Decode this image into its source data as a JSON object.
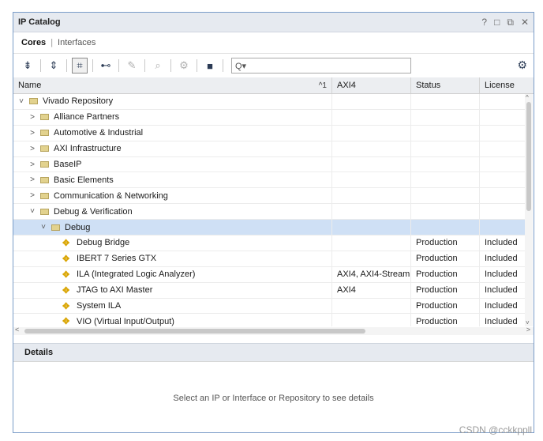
{
  "window": {
    "title": "IP Catalog",
    "controls": [
      "?",
      "□",
      "⧉",
      "✕"
    ]
  },
  "tabs": {
    "active": "Cores",
    "separator": "|",
    "other": "Interfaces"
  },
  "search": {
    "placeholder": "Q▾"
  },
  "columns": {
    "name": "Name",
    "sort_indicator": "^1",
    "axi4": "AXI4",
    "status": "Status",
    "license": "License"
  },
  "rows": [
    {
      "indent": 0,
      "expanded": "˅",
      "kind": "folder",
      "name": "Vivado Repository",
      "axi": "",
      "status": "",
      "license": ""
    },
    {
      "indent": 1,
      "expanded": ">",
      "kind": "folder",
      "name": "Alliance Partners",
      "axi": "",
      "status": "",
      "license": ""
    },
    {
      "indent": 1,
      "expanded": ">",
      "kind": "folder",
      "name": "Automotive & Industrial",
      "axi": "",
      "status": "",
      "license": ""
    },
    {
      "indent": 1,
      "expanded": ">",
      "kind": "folder",
      "name": "AXI Infrastructure",
      "axi": "",
      "status": "",
      "license": ""
    },
    {
      "indent": 1,
      "expanded": ">",
      "kind": "folder",
      "name": "BaseIP",
      "axi": "",
      "status": "",
      "license": ""
    },
    {
      "indent": 1,
      "expanded": ">",
      "kind": "folder",
      "name": "Basic Elements",
      "axi": "",
      "status": "",
      "license": ""
    },
    {
      "indent": 1,
      "expanded": ">",
      "kind": "folder",
      "name": "Communication & Networking",
      "axi": "",
      "status": "",
      "license": ""
    },
    {
      "indent": 1,
      "expanded": "˅",
      "kind": "folder",
      "name": "Debug & Verification",
      "axi": "",
      "status": "",
      "license": ""
    },
    {
      "indent": 2,
      "expanded": "˅",
      "kind": "folder",
      "name": "Debug",
      "axi": "",
      "status": "",
      "license": "",
      "selected": true
    },
    {
      "indent": 3,
      "expanded": "",
      "kind": "ip",
      "name": "Debug Bridge",
      "axi": "",
      "status": "Production",
      "license": "Included"
    },
    {
      "indent": 3,
      "expanded": "",
      "kind": "ip",
      "name": "IBERT 7 Series GTX",
      "axi": "",
      "status": "Production",
      "license": "Included"
    },
    {
      "indent": 3,
      "expanded": "",
      "kind": "ip",
      "name": "ILA (Integrated Logic Analyzer)",
      "axi": "AXI4, AXI4-Stream",
      "status": "Production",
      "license": "Included"
    },
    {
      "indent": 3,
      "expanded": "",
      "kind": "ip",
      "name": "JTAG to AXI Master",
      "axi": "AXI4",
      "status": "Production",
      "license": "Included"
    },
    {
      "indent": 3,
      "expanded": "",
      "kind": "ip",
      "name": "System ILA",
      "axi": "",
      "status": "Production",
      "license": "Included"
    },
    {
      "indent": 3,
      "expanded": "",
      "kind": "ip",
      "name": "VIO (Virtual Input/Output)",
      "axi": "",
      "status": "Production",
      "license": "Included"
    }
  ],
  "details": {
    "title": "Details",
    "message": "Select an IP or Interface or Repository to see details"
  },
  "watermark": "CSDN @cckkppll"
}
